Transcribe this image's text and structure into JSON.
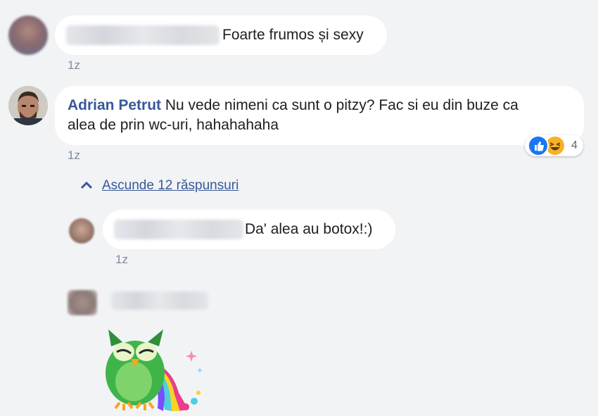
{
  "comments": [
    {
      "text": "Foarte frumos și sexy",
      "time": "1z"
    },
    {
      "author": "Adrian Petrut",
      "text_line1": "Nu vede nimeni ca sunt o pitzy? Fac si eu din buze ca",
      "text_line2": "alea de prin wc-uri, hahahahaha",
      "time": "1z",
      "reactions": {
        "count": "4",
        "types": [
          "like-icon",
          "haha-icon"
        ],
        "like_color": "#1877f2",
        "haha_color": "#f7b125"
      },
      "replies_toggle": "Ascunde 12 răspunsuri"
    }
  ],
  "replies": [
    {
      "text": "Da' alea au botox!:)",
      "time": "1z"
    },
    {
      "sticker": "crying-owl-rainbow-sticker"
    }
  ],
  "colors": {
    "background": "#f2f3f5",
    "bubble": "#ffffff",
    "link": "#385898",
    "time": "#7d8a9c"
  }
}
